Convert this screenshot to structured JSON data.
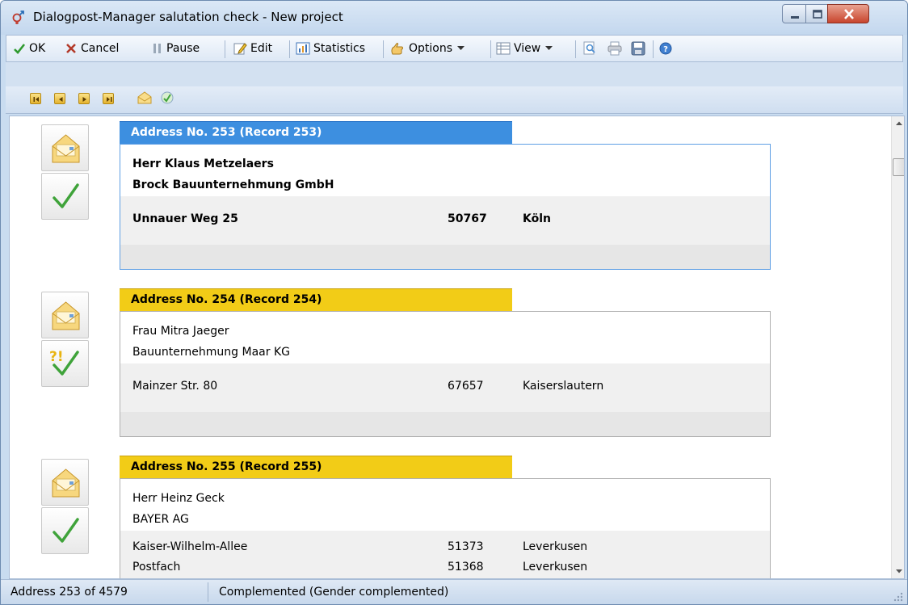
{
  "window": {
    "title": "Dialogpost-Manager salutation check - New project"
  },
  "toolbar": {
    "ok_label": "OK",
    "cancel_label": "Cancel",
    "pause_label": "Pause",
    "edit_label": "Edit",
    "statistics_label": "Statistics",
    "options_label": "Options",
    "view_label": "View"
  },
  "navbar": {
    "buttons": [
      "first-record-icon",
      "previous-record-icon",
      "next-record-icon",
      "last-record-icon",
      "open-envelope-icon",
      "refresh-icon"
    ]
  },
  "records": [
    {
      "header": "Address No. 253 (Record 253)",
      "state": "active",
      "status_icon": "checkmark-icon",
      "name": "Herr Klaus Metzelaers",
      "company": "Brock Bauunternehmung GmbH",
      "addresses": [
        {
          "street": "Unnauer Weg 25",
          "zip": "50767",
          "city": "Köln"
        }
      ]
    },
    {
      "header": "Address No. 254 (Record 254)",
      "state": "inactive",
      "status_icon": "uncertain-checkmark-icon",
      "name": "Frau Mitra Jaeger",
      "company": "Bauunternehmung Maar KG",
      "addresses": [
        {
          "street": "Mainzer Str. 80",
          "zip": "67657",
          "city": "Kaiserslautern"
        }
      ]
    },
    {
      "header": "Address No. 255 (Record 255)",
      "state": "inactive",
      "status_icon": "checkmark-icon",
      "name": "Herr Heinz Geck",
      "company": "BAYER AG",
      "addresses": [
        {
          "street": "Kaiser-Wilhelm-Allee",
          "zip": "51373",
          "city": "Leverkusen"
        },
        {
          "street": "Postfach",
          "zip": "51368",
          "city": "Leverkusen"
        }
      ]
    }
  ],
  "statusbar": {
    "position": "Address 253 of 4579",
    "message": "Complemented (Gender complemented)"
  },
  "colors": {
    "active_tab": "#3d8fe0",
    "inactive_tab": "#f2cc17",
    "check_green": "#3fa33a"
  }
}
